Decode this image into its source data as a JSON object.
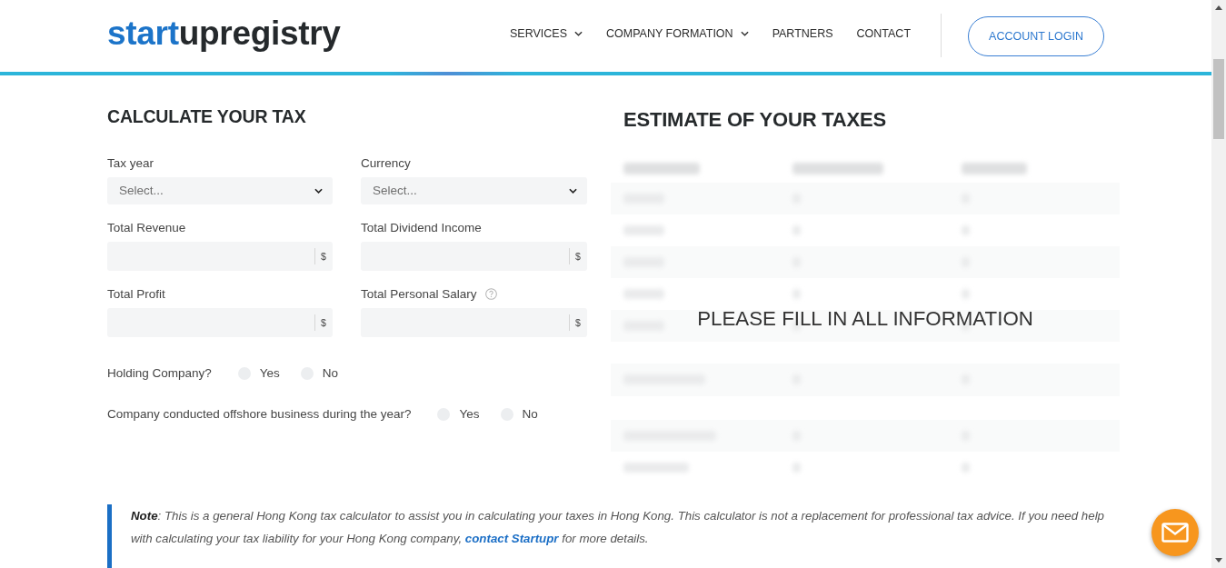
{
  "header": {
    "logo": {
      "accent": "start",
      "rest": "upregistry"
    },
    "nav": [
      {
        "label": "SERVICES",
        "dropdown": true
      },
      {
        "label": "COMPANY FORMATION",
        "dropdown": true
      },
      {
        "label": "PARTNERS",
        "dropdown": false
      },
      {
        "label": "CONTACT",
        "dropdown": false
      }
    ],
    "login_button": "ACCOUNT LOGIN"
  },
  "calculator": {
    "title": "CALCULATE YOUR TAX",
    "fields": [
      {
        "kind": "select",
        "label": "Tax year",
        "placeholder": "Select...",
        "help": false
      },
      {
        "kind": "select",
        "label": "Currency",
        "placeholder": "Select...",
        "help": false
      },
      {
        "kind": "amount",
        "label": "Total Revenue",
        "unit": "$",
        "help": false
      },
      {
        "kind": "amount",
        "label": "Total Dividend Income",
        "unit": "$",
        "help": false
      },
      {
        "kind": "amount",
        "label": "Total Profit",
        "unit": "$",
        "help": false
      },
      {
        "kind": "amount",
        "label": "Total Personal Salary",
        "unit": "$",
        "help": true
      }
    ],
    "questions": [
      {
        "label": "Holding Company?",
        "options": [
          {
            "label": "Yes",
            "selected": false
          },
          {
            "label": "No",
            "selected": false
          }
        ]
      },
      {
        "label": "Company conducted offshore business during the year?",
        "options": [
          {
            "label": "Yes",
            "selected": false
          },
          {
            "label": "No",
            "selected": false
          }
        ]
      }
    ]
  },
  "estimate": {
    "title": "ESTIMATE OF YOUR TAXES",
    "message": "PLEASE FILL IN ALL INFORMATION"
  },
  "note": {
    "text": "**Note**: This is a general Hong Kong tax calculator to assist you in calculating your taxes in Hong Kong. This calculator is not a replacement for professional tax advice. If you need help with calculating your tax liability for your Hong Kong company, ",
    "link": "contact Startupr",
    "after": " for more details."
  }
}
